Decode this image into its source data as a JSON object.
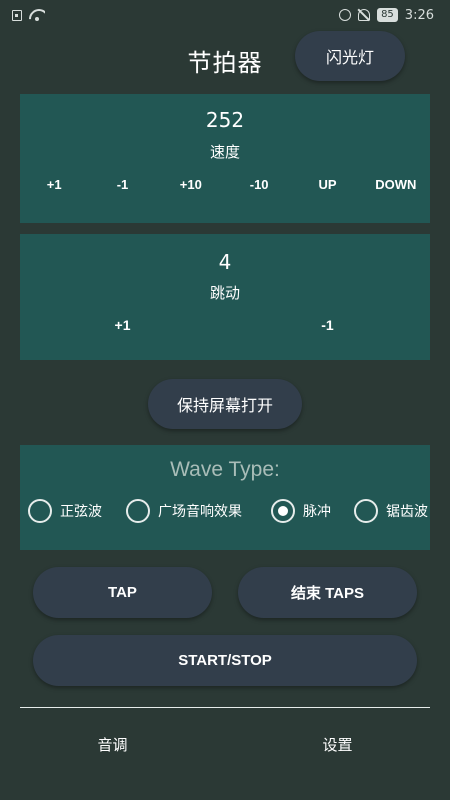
{
  "status_bar": {
    "time": "3:26",
    "battery": "85",
    "icons": [
      "sim-icon",
      "wifi-icon",
      "alarm-icon",
      "bell-muted-icon",
      "battery-icon"
    ]
  },
  "header": {
    "title": "节拍器",
    "flash_label": "闪光灯"
  },
  "tempo": {
    "value": "252",
    "label": "速度",
    "buttons": [
      "+1",
      "-1",
      "+10",
      "-10",
      "UP",
      "DOWN"
    ]
  },
  "beat": {
    "value": "4",
    "label": "跳动",
    "buttons": [
      "+1",
      "-1"
    ]
  },
  "keep_screen_label": "保持屏幕打开",
  "wave": {
    "title": "Wave Type:",
    "options": [
      "正弦波",
      "广场音响效果",
      "脉冲",
      "锯齿波"
    ],
    "selected": "脉冲"
  },
  "controls": {
    "tap_label": "TAP",
    "end_tap_label": "结束 TAPS",
    "start_stop_label": "START/STOP"
  },
  "nav": {
    "items": [
      "音调",
      "设置"
    ]
  },
  "colors": {
    "background": "#2b3935",
    "panel": "#225754",
    "button": "#323e4b",
    "wave_title": "#a9bdb8"
  }
}
